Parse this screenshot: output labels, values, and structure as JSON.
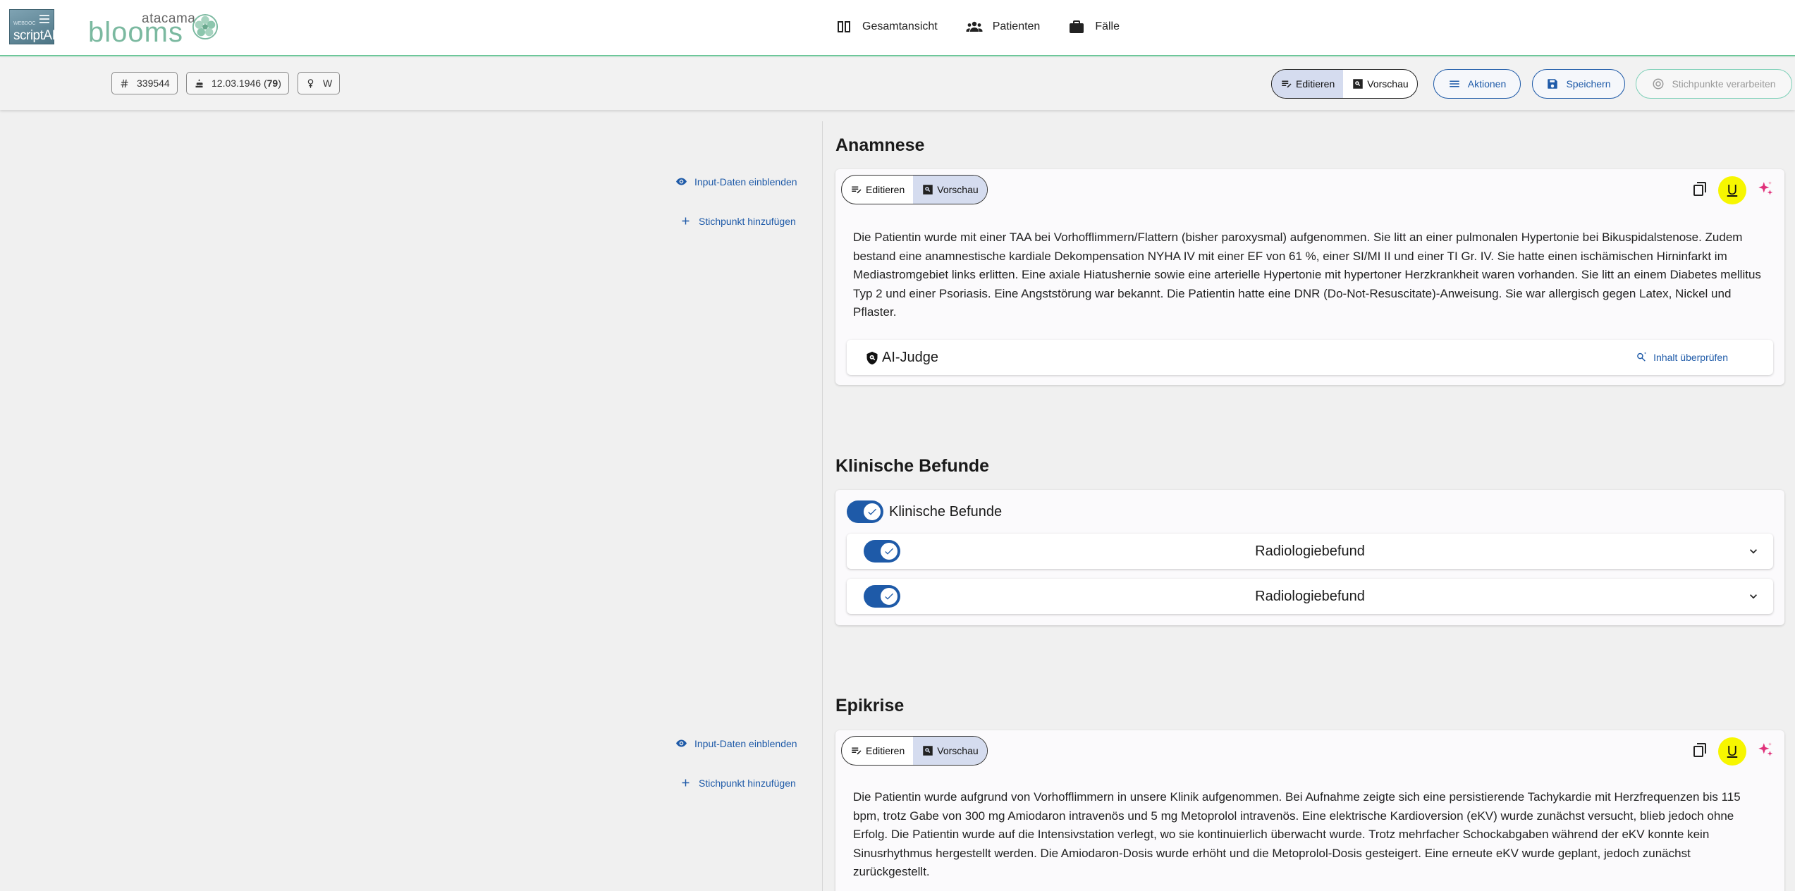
{
  "logos": {
    "scriptai_small": "WEBDOC",
    "scriptai_main": "scriptAI",
    "blooms_top": "atacama",
    "blooms_main": "blooms"
  },
  "nav": {
    "items": [
      {
        "label": "Gesamtansicht",
        "icon": "columns-icon"
      },
      {
        "label": "Patienten",
        "icon": "people-icon"
      },
      {
        "label": "Fälle",
        "icon": "briefcase-icon"
      }
    ]
  },
  "patient": {
    "id": "339544",
    "birthdate": "12.03.1946",
    "age": "79",
    "sex": "W"
  },
  "toolbar": {
    "edit_label": "Editieren",
    "preview_label": "Vorschau",
    "actions_label": "Aktionen",
    "save_label": "Speichern",
    "process_label": "Stichpunkte verarbeiten"
  },
  "side": {
    "show_input": "Input-Daten einblenden",
    "add_point": "Stichpunkt hinzufügen"
  },
  "sections": {
    "anamnese": {
      "title": "Anamnese",
      "edit_label": "Editieren",
      "preview_label": "Vorschau",
      "text": "Die Patientin wurde mit einer TAA bei Vorhofflimmern/Flattern (bisher paroxysmal) aufgenommen. Sie litt an einer pulmonalen Hypertonie bei Bikuspidalstenose. Zudem bestand eine anamnestische kardiale Dekompensation NYHA IV mit einer EF von 61 %, einer SI/MI II und einer TI Gr. IV. Sie hatte einen ischämischen Hirninfarkt im Mediastromgebiet links erlitten. Eine axiale Hiatushernie sowie eine arterielle Hypertonie mit hypertoner Herzkrankheit waren vorhanden. Sie litt an einem Diabetes mellitus Typ 2 und einer Psoriasis. Eine Angststörung war bekannt. Die Patientin hatte eine DNR (Do-Not-Resuscitate)-Anweisung. Sie war allergisch gegen Latex, Nickel und Pflaster.",
      "judge_label": "AI-Judge",
      "judge_action": "Inhalt überprüfen"
    },
    "befunde": {
      "title": "Klinische Befunde",
      "toggle_label": "Klinische Befunde",
      "rows": [
        {
          "label": "Radiologiebefund"
        },
        {
          "label": "Radiologiebefund"
        }
      ]
    },
    "epikrise": {
      "title": "Epikrise",
      "edit_label": "Editieren",
      "preview_label": "Vorschau",
      "text": "Die Patientin wurde aufgrund von Vorhofflimmern in unsere Klinik aufgenommen. Bei Aufnahme zeigte sich eine persistierende Tachykardie mit Herzfrequenzen bis 115 bpm, trotz Gabe von 300 mg Amiodaron intravenös und 5 mg Metoprolol intravenös. Eine elektrische Kardioversion (eKV) wurde zunächst versucht, blieb jedoch ohne Erfolg. Die Patientin wurde auf die Intensivstation verlegt, wo sie kontinuierlich überwacht wurde. Trotz mehrfacher Schockabgaben während der eKV konnte kein Sinusrhythmus hergestellt werden. Die Amiodaron-Dosis wurde erhöht und die Metoprolol-Dosis gesteigert. Eine erneute eKV wurde geplant, jedoch zunächst zurückgestellt."
    }
  },
  "tools": {
    "u_label": "U"
  },
  "colors": {
    "accent": "#1e5aa8",
    "brand_green": "#6ec79a",
    "highlight_yellow": "#f7f600",
    "segment_active": "#d5dcef"
  }
}
